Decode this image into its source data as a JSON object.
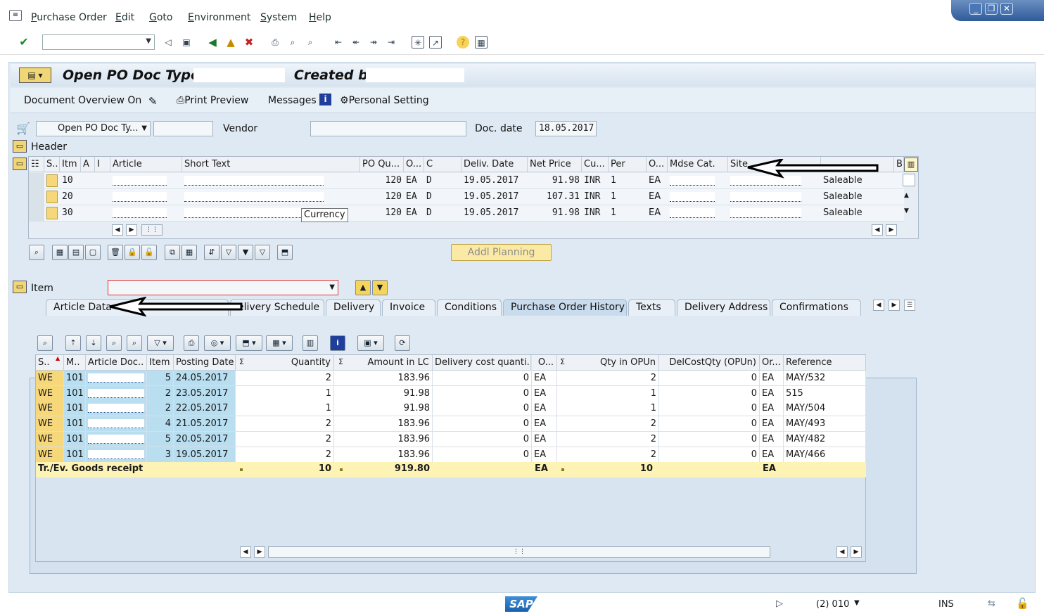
{
  "menu": [
    "Purchase Order",
    "Edit",
    "Goto",
    "Environment",
    "System",
    "Help"
  ],
  "title": {
    "part1": "Open PO Doc Type",
    "part2": "Created by"
  },
  "app_toolbar": {
    "document_overview": "Document Overview On",
    "print_preview": "Print Preview",
    "messages": "Messages",
    "personal_setting": "Personal Setting"
  },
  "header_fields": {
    "doc_type": "Open PO Doc Ty...",
    "vendor_label": "Vendor",
    "doc_date_label": "Doc. date",
    "doc_date": "18.05.2017",
    "header_label": "Header"
  },
  "items_grid": {
    "columns": [
      "S..",
      "Itm",
      "A",
      "I",
      "Article",
      "Short Text",
      "PO Qu...",
      "O...",
      "C",
      "Deliv. Date",
      "Net Price",
      "Cu...",
      "Per",
      "O...",
      "Mdse Cat.",
      "Site",
      "",
      "B"
    ],
    "rows": [
      {
        "itm": "10",
        "qty": "120",
        "uom": "EA",
        "c": "D",
        "date": "19.05.2017",
        "price": "91.98",
        "cur": "INR",
        "per": "1",
        "ou": "EA",
        "stock": "Saleable"
      },
      {
        "itm": "20",
        "qty": "120",
        "uom": "EA",
        "c": "D",
        "date": "19.05.2017",
        "price": "107.31",
        "cur": "INR",
        "per": "1",
        "ou": "EA",
        "stock": "Saleable"
      },
      {
        "itm": "30",
        "qty": "120",
        "uom": "EA",
        "c": "D",
        "date": "19.05.2017",
        "price": "91.98",
        "cur": "INR",
        "per": "1",
        "ou": "EA",
        "stock": "Saleable"
      }
    ],
    "tooltip": "Currency"
  },
  "addl_planning": "Addl Planning",
  "item_label": "Item",
  "tabs": [
    "Article Data",
    "elivery Schedule",
    "Delivery",
    "Invoice",
    "Conditions",
    "Purchase Order History",
    "Texts",
    "Delivery Address",
    "Confirmations"
  ],
  "history_grid": {
    "columns": [
      "S..",
      "M..",
      "Article Doc..",
      "Item",
      "Posting Date",
      "Σ",
      "Quantity",
      "Σ",
      "Amount in LC",
      "Delivery cost quanti...",
      "O...",
      "Σ",
      "Qty in OPUn",
      "DelCostQty (OPUn)",
      "Or...",
      "Reference"
    ],
    "rows": [
      {
        "s": "WE",
        "m": "101",
        "item": "5",
        "date": "24.05.2017",
        "qty": "2",
        "amt": "183.96",
        "dcq": "0",
        "o": "EA",
        "qop": "2",
        "dcqop": "0",
        "or": "EA",
        "ref": "MAY/532"
      },
      {
        "s": "WE",
        "m": "101",
        "item": "2",
        "date": "23.05.2017",
        "qty": "1",
        "amt": "91.98",
        "dcq": "0",
        "o": "EA",
        "qop": "1",
        "dcqop": "0",
        "or": "EA",
        "ref": "515"
      },
      {
        "s": "WE",
        "m": "101",
        "item": "2",
        "date": "22.05.2017",
        "qty": "1",
        "amt": "91.98",
        "dcq": "0",
        "o": "EA",
        "qop": "1",
        "dcqop": "0",
        "or": "EA",
        "ref": "MAY/504"
      },
      {
        "s": "WE",
        "m": "101",
        "item": "4",
        "date": "21.05.2017",
        "qty": "2",
        "amt": "183.96",
        "dcq": "0",
        "o": "EA",
        "qop": "2",
        "dcqop": "0",
        "or": "EA",
        "ref": "MAY/493"
      },
      {
        "s": "WE",
        "m": "101",
        "item": "5",
        "date": "20.05.2017",
        "qty": "2",
        "amt": "183.96",
        "dcq": "0",
        "o": "EA",
        "qop": "2",
        "dcqop": "0",
        "or": "EA",
        "ref": "MAY/482"
      },
      {
        "s": "WE",
        "m": "101",
        "item": "3",
        "date": "19.05.2017",
        "qty": "2",
        "amt": "183.96",
        "dcq": "0",
        "o": "EA",
        "qop": "2",
        "dcqop": "0",
        "or": "EA",
        "ref": "MAY/466"
      }
    ],
    "total": {
      "label": "Tr./Ev. Goods receipt",
      "qty": "10",
      "amt": "919.80",
      "o": "EA",
      "qop": "10",
      "or": "EA"
    }
  },
  "status": {
    "session": "(2) 010",
    "mode": "INS",
    "logo": "SAP"
  },
  "colors": {
    "accent": "#2f5a9a",
    "total_row": "#fdf3b5",
    "key_cell": "#b8def0",
    "we_cell": "#f6d77a"
  }
}
